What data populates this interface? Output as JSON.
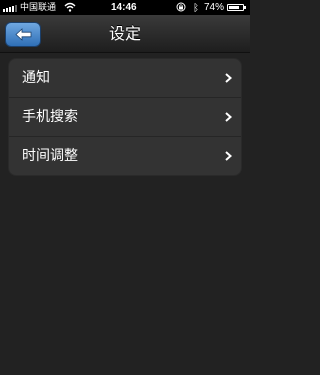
{
  "status_bar": {
    "carrier": "中国联通",
    "time": "14:46",
    "battery_percent": "74%",
    "battery_level": 0.74,
    "bluetooth_icon": "ᛒ"
  },
  "nav": {
    "title": "设定",
    "back_icon": "arrow-left-icon",
    "accent_color": "#3f7fc6"
  },
  "settings": {
    "items": [
      {
        "label": "通知",
        "icon": "chevron-right-icon"
      },
      {
        "label": "手机搜索",
        "icon": "chevron-right-icon"
      },
      {
        "label": "时间调整",
        "icon": "chevron-right-icon"
      }
    ]
  }
}
